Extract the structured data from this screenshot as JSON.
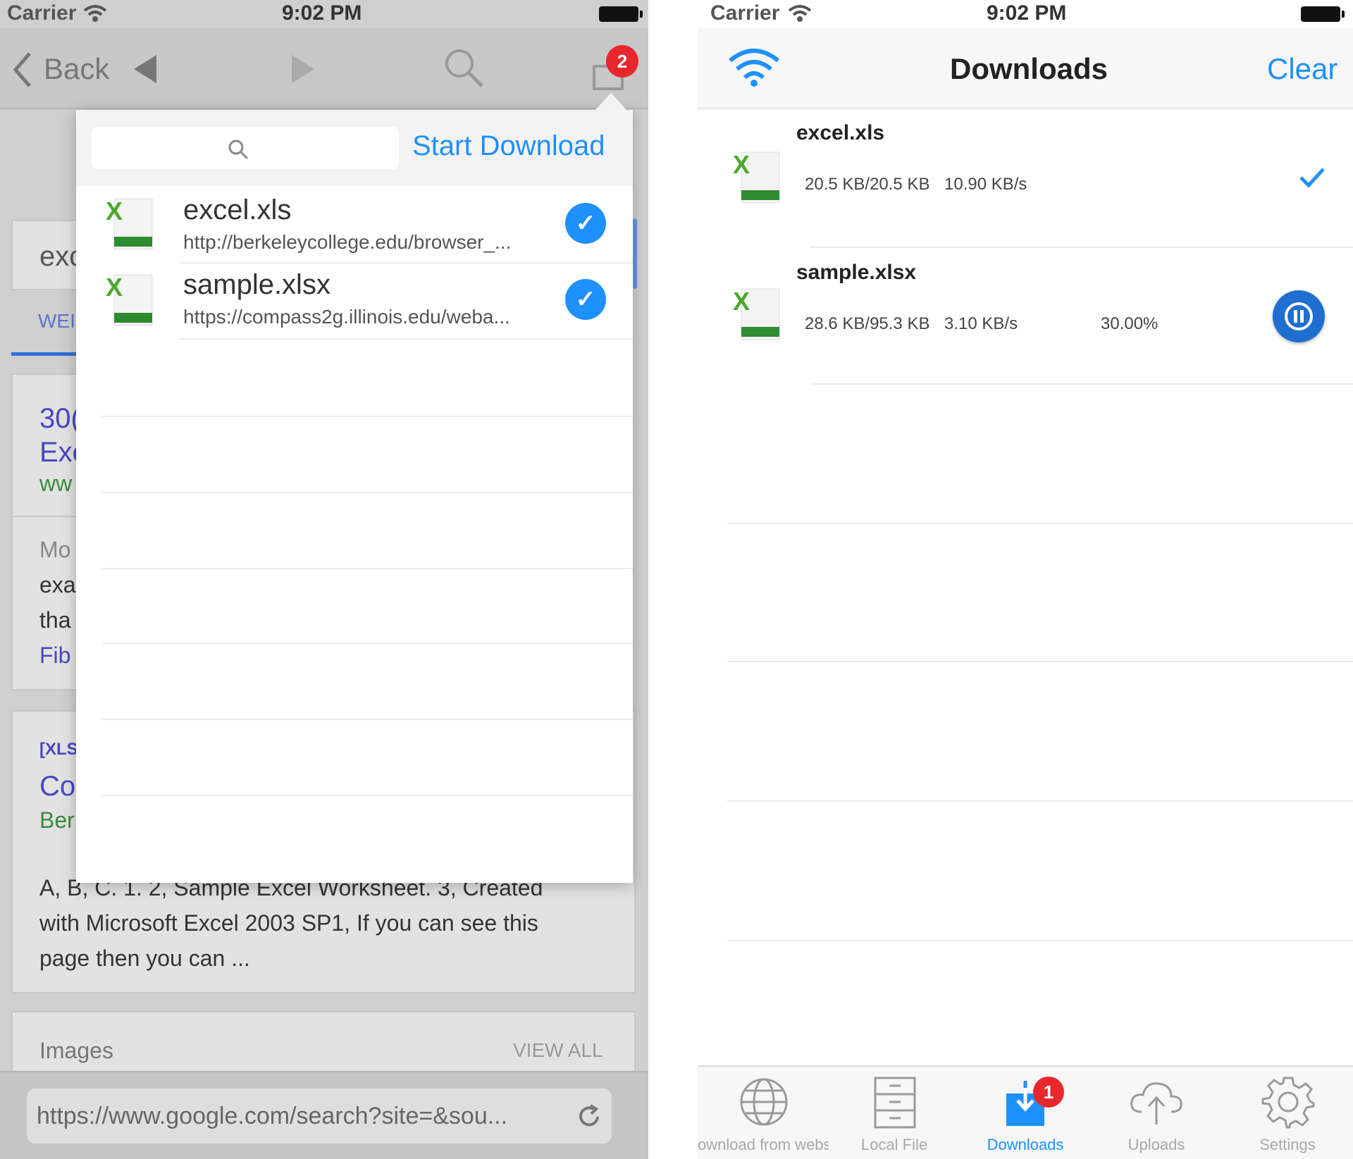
{
  "left": {
    "status": {
      "carrier": "Carrier",
      "time": "9:02 PM"
    },
    "nav": {
      "back_label": "Back",
      "badge_count": "2"
    },
    "page": {
      "query_partial": "exc",
      "tab_partial": "WEI",
      "result1": {
        "line1": "30(",
        "line2": "Exc",
        "url": "ww"
      },
      "snippet1": [
        "Mo",
        "exa",
        "tha",
        "Fib"
      ],
      "result2": {
        "tag": "[XLS",
        "title": "Co",
        "url": "Ber"
      },
      "snippet2": {
        "line1": "A, B, C. 1. 2, Sample Excel Worksheet. 3, Created",
        "line2": "with Microsoft Excel 2003 SP1, If you can see this",
        "line3": "page then you can ..."
      },
      "images_label": "Images",
      "view_all": "VIEW ALL"
    },
    "popover": {
      "start_download": "Start Download",
      "files": [
        {
          "name": "excel.xls",
          "url": "http://berkeleycollege.edu/browser_..."
        },
        {
          "name": "sample.xlsx",
          "url": "https://compass2g.illinois.edu/weba..."
        }
      ]
    },
    "urlbar": {
      "url": "https://www.google.com/search?site=&sou..."
    }
  },
  "right": {
    "status": {
      "carrier": "Carrier",
      "time": "9:02 PM"
    },
    "nav": {
      "title": "Downloads",
      "clear_label": "Clear"
    },
    "downloads": [
      {
        "name": "excel.xls",
        "progress": "20.5 KB/20.5 KB",
        "speed": "10.90 KB/s",
        "percent": "",
        "state": "done"
      },
      {
        "name": "sample.xlsx",
        "progress": "28.6 KB/95.3 KB",
        "speed": "3.10 KB/s",
        "percent": "30.00%",
        "state": "paused"
      }
    ],
    "tabs": [
      {
        "label": "ownload from website",
        "icon": "globe-icon"
      },
      {
        "label": "Local File",
        "icon": "file-cabinet-icon"
      },
      {
        "label": "Downloads",
        "icon": "download-icon",
        "badge": "1"
      },
      {
        "label": "Uploads",
        "icon": "cloud-upload-icon"
      },
      {
        "label": "Settings",
        "icon": "gear-icon"
      }
    ]
  },
  "colors": {
    "accent": "#1e90ff",
    "badge": "#e8282c",
    "excel_green": "#2e8b2e"
  }
}
